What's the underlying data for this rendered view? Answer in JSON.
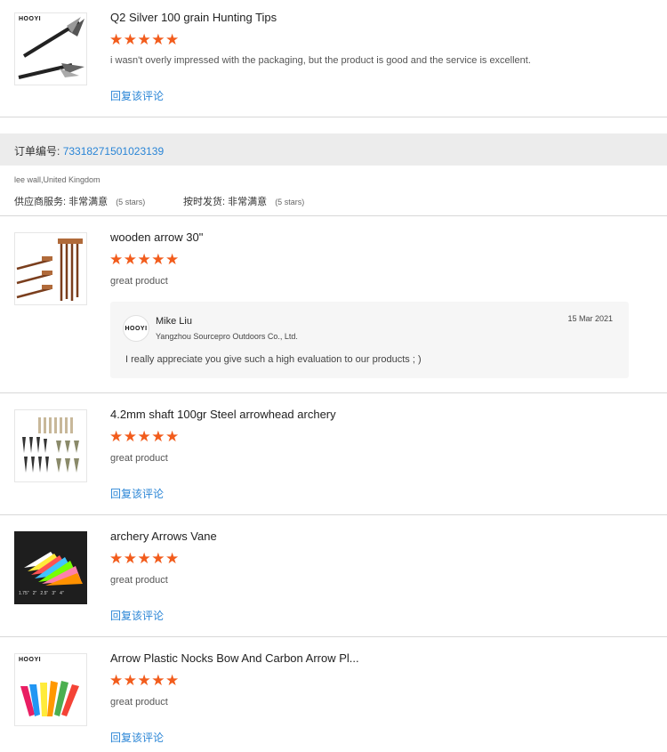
{
  "items": [
    {
      "title": "Q2 Silver 100 grain Hunting Tips",
      "stars": "★★★★★",
      "comment": "i wasn't overly impressed with the packaging, but the product is good and the service is excellent.",
      "reply_label": "回复该评论",
      "brand": "HOOYI"
    },
    {
      "title": "wooden arrow 30\"",
      "stars": "★★★★★",
      "comment": "great product"
    },
    {
      "title": "4.2mm shaft 100gr Steel arrowhead archery",
      "stars": "★★★★★",
      "comment": "great product",
      "reply_label": "回复该评论"
    },
    {
      "title": "archery Arrows Vane",
      "stars": "★★★★★",
      "comment": "great product",
      "reply_label": "回复该评论",
      "sizes": [
        "1.75\"",
        "2\"",
        "2.5\"",
        "3\"",
        "4\""
      ]
    },
    {
      "title": "Arrow Plastic Nocks Bow And Carbon Arrow Pl...",
      "stars": "★★★★★",
      "comment": "great product",
      "reply_label": "回复该评论",
      "brand": "HOOYI"
    }
  ],
  "order": {
    "label": "订单编号:",
    "number": "73318271501023139",
    "buyer": "lee wall,United Kingdom",
    "supplier_service_label": "供应商服务:",
    "supplier_service_value": "非常满意",
    "supplier_service_stars": "(5 stars)",
    "shipping_label": "按时发货:",
    "shipping_value": "非常满意",
    "shipping_stars": "(5 stars)"
  },
  "seller_reply": {
    "avatar": "HOOYI",
    "name": "Mike Liu",
    "company": "Yangzhou Sourcepro Outdoors Co., Ltd.",
    "date": "15 Mar 2021",
    "text": "I really appreciate you give such a high evaluation to our products ; )"
  },
  "colors": {
    "star": "#f25c1c",
    "link": "#2a85d6",
    "order_bar": "#ececec"
  }
}
